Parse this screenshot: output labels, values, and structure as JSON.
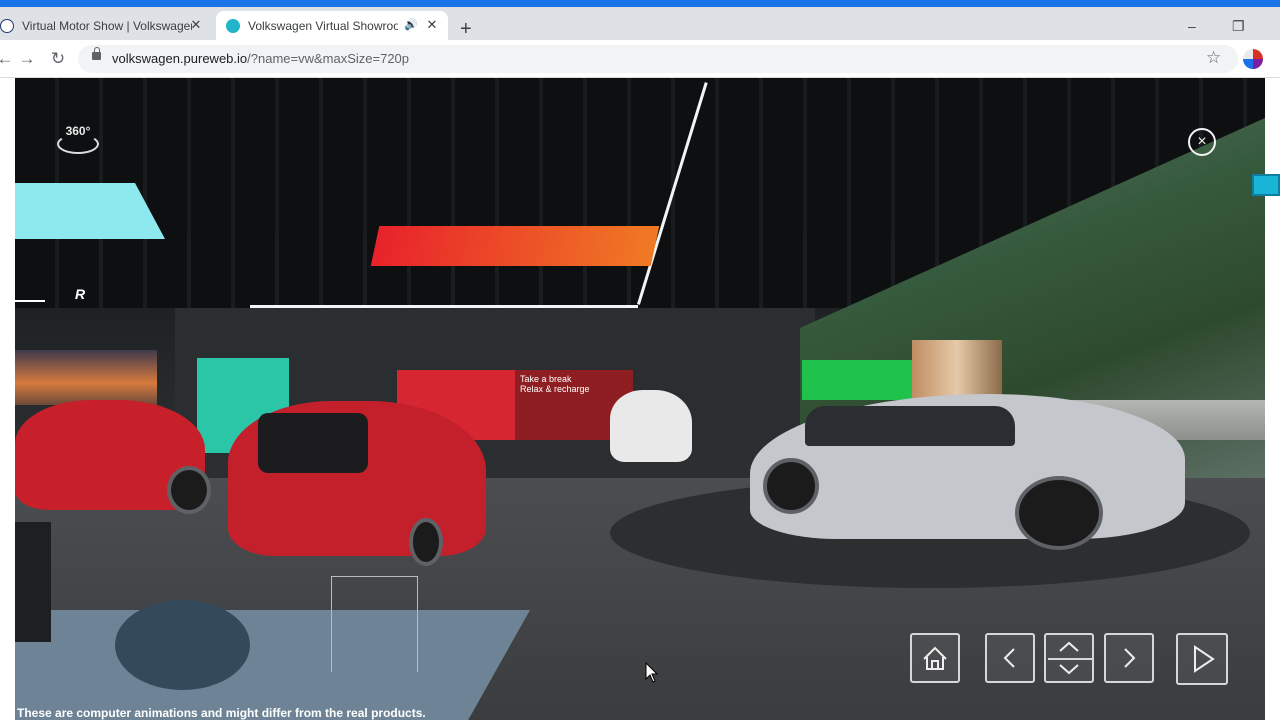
{
  "browser": {
    "tabs": [
      {
        "title": "Virtual Motor Show | Volkswagen",
        "favicon": "vw-logo-icon",
        "active": false
      },
      {
        "title": "Volkswagen Virtual Showroom",
        "favicon": "pureweb-icon",
        "active": true,
        "audio": true
      }
    ],
    "new_tab": "+",
    "window_controls": {
      "minimize": "–",
      "restore": "❐",
      "close": "✕"
    },
    "nav": {
      "back": "←",
      "forward": "→",
      "reload": "↻"
    },
    "url": {
      "host": "volkswagen.pureweb.io",
      "path": "/?name=vw&maxSize=720p"
    },
    "bookmark": "☆"
  },
  "scene": {
    "icon_360_label": "360°",
    "close_symbol": "×",
    "ad_text_line1": "Take a break",
    "ad_text_line2": "Relax & recharge",
    "disclaimer": "These are computer animations and might differ from the real products."
  },
  "colors": {
    "accent": "#1a73e8",
    "tab_strip": "#dee1e6",
    "orange_panel_start": "#e8222b",
    "orange_panel_end": "#f07a24"
  }
}
